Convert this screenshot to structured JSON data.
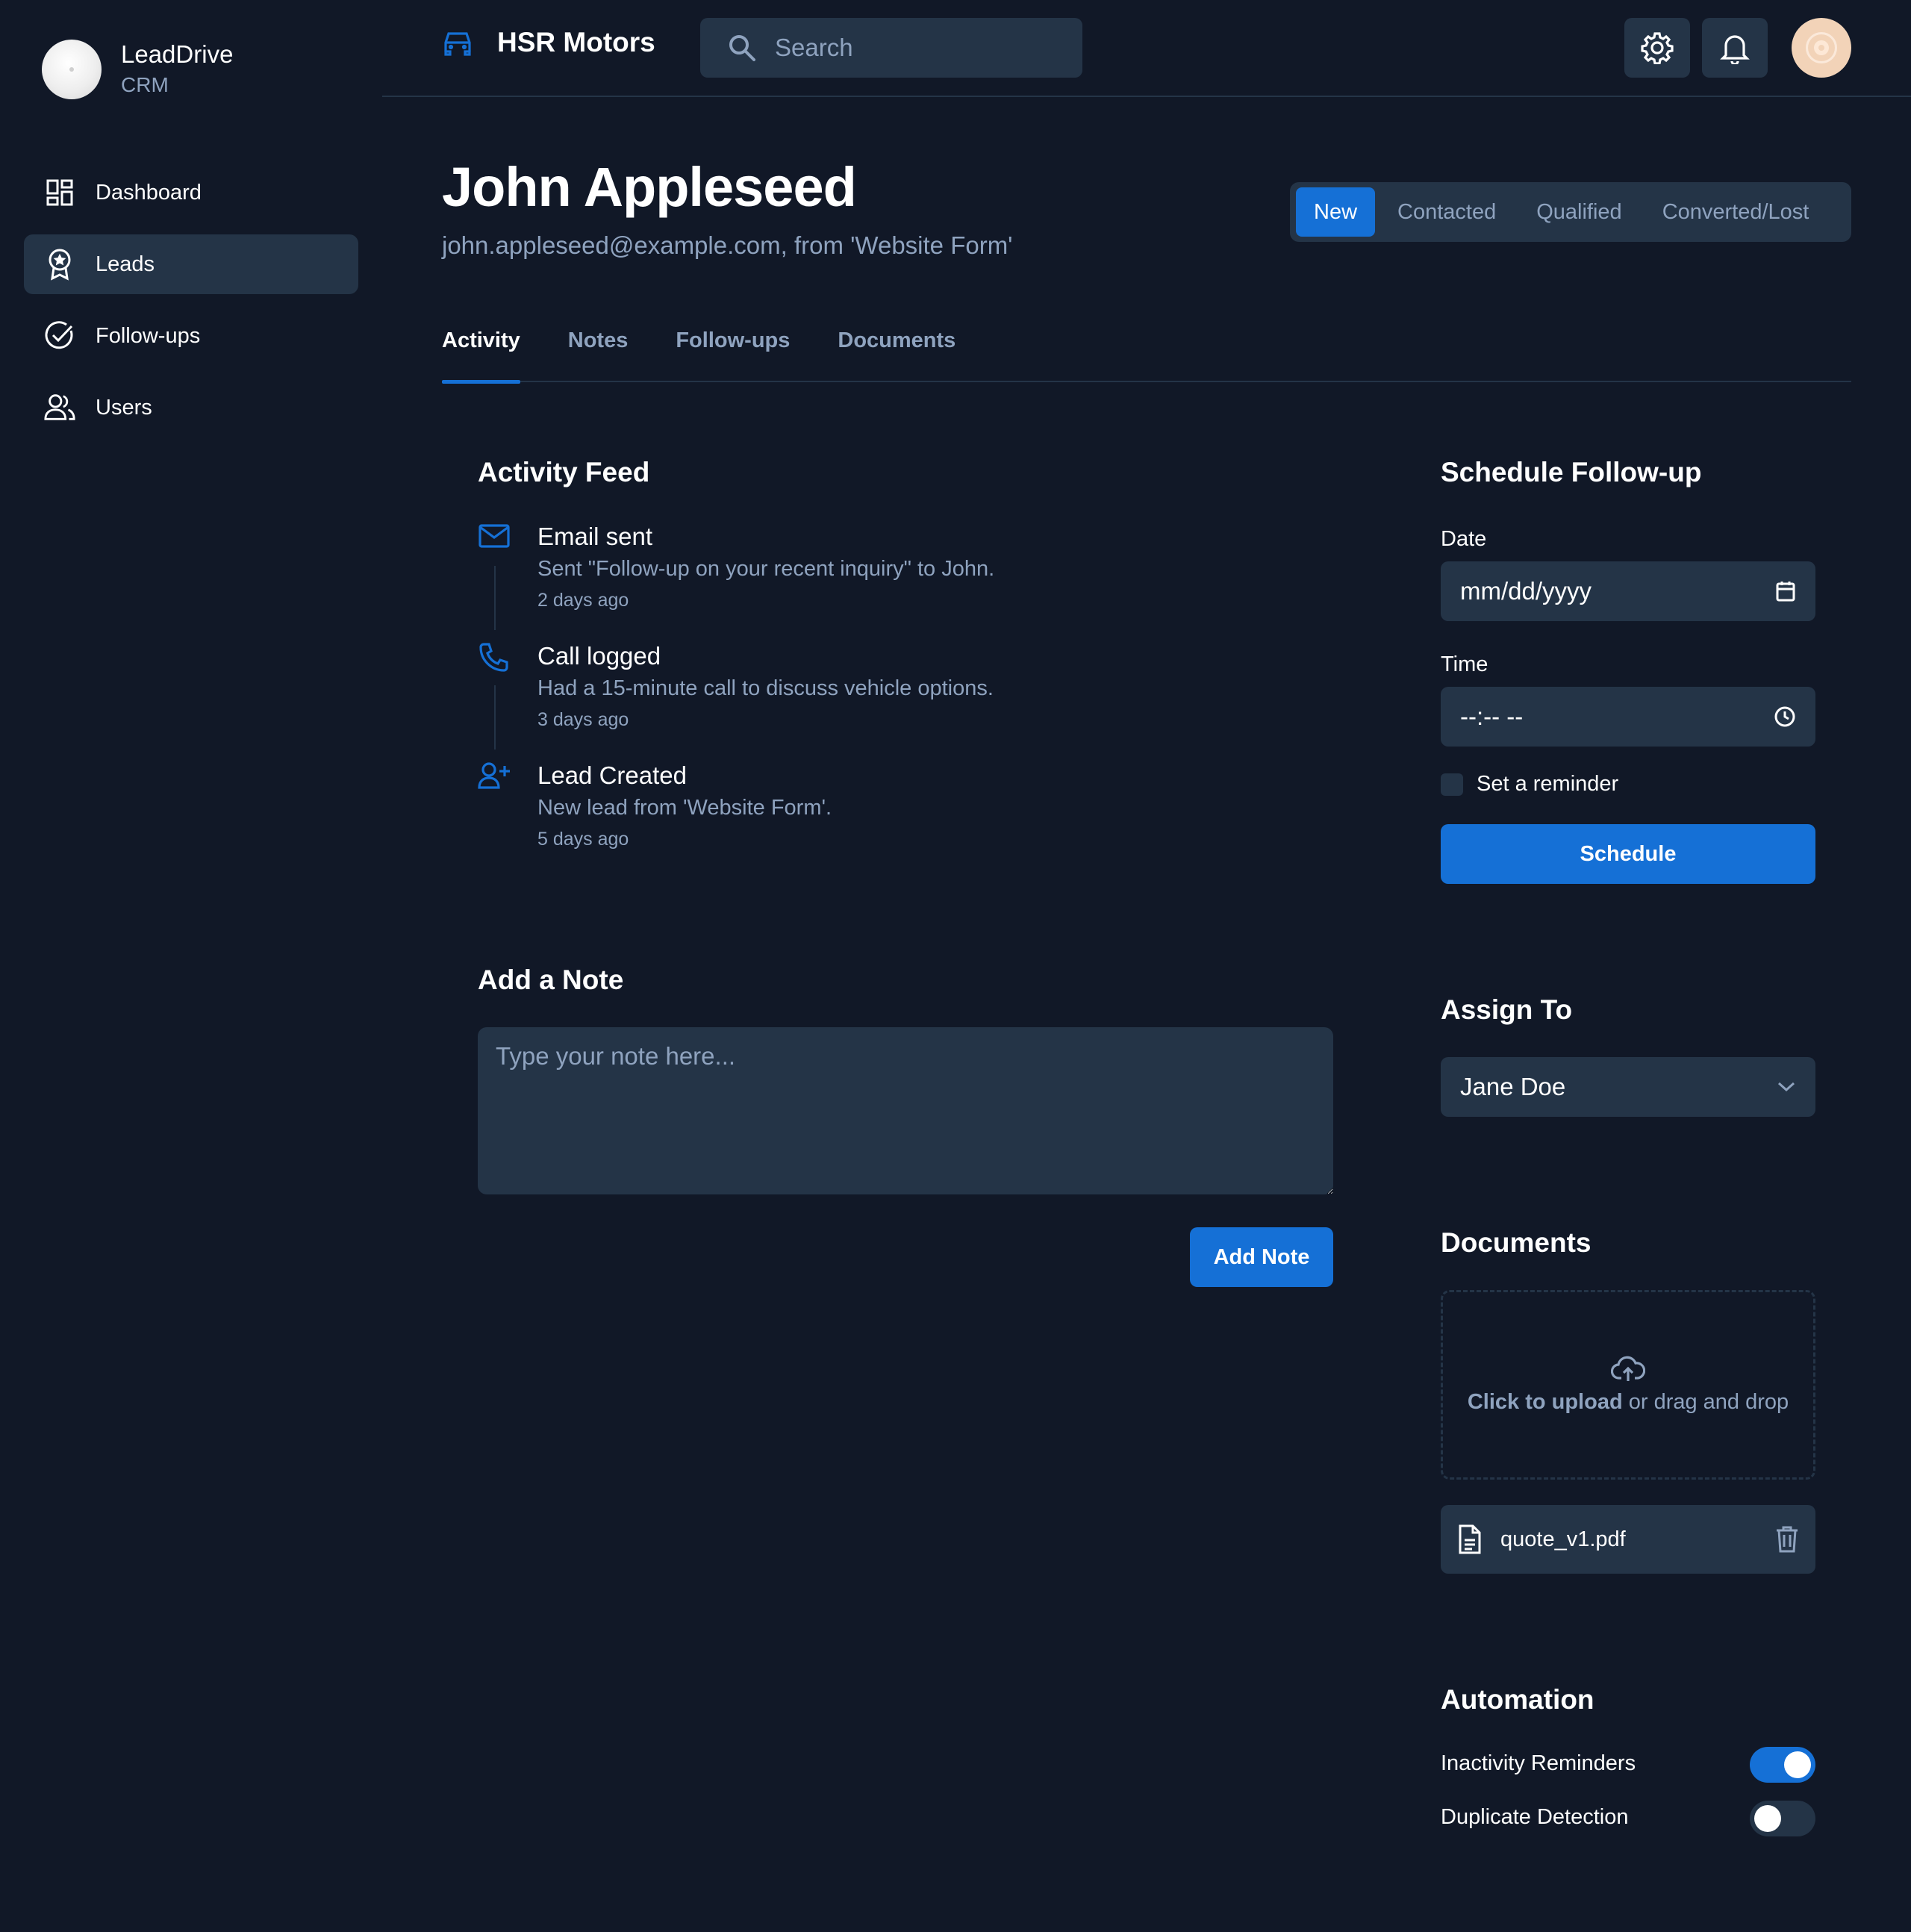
{
  "brand": {
    "name": "LeadDrive",
    "subtitle": "CRM"
  },
  "sidebar": {
    "items": [
      {
        "label": "Dashboard",
        "icon": "dashboard-icon",
        "active": false
      },
      {
        "label": "Leads",
        "icon": "badge-star-icon",
        "active": true
      },
      {
        "label": "Follow-ups",
        "icon": "check-circle-icon",
        "active": false
      },
      {
        "label": "Users",
        "icon": "users-icon",
        "active": false
      }
    ]
  },
  "topbar": {
    "company": "HSR Motors",
    "company_icon": "car-icon",
    "search_placeholder": "Search",
    "settings_icon": "gear-icon",
    "notifications_icon": "bell-icon"
  },
  "lead": {
    "name": "John Appleseed",
    "subtitle": "john.appleseed@example.com, from 'Website Form'"
  },
  "status": {
    "options": [
      "New",
      "Contacted",
      "Qualified",
      "Converted/Lost"
    ],
    "selected": "New"
  },
  "tabs": [
    "Activity",
    "Notes",
    "Follow-ups",
    "Documents"
  ],
  "active_tab": "Activity",
  "activity": {
    "title": "Activity Feed",
    "items": [
      {
        "icon": "mail-icon",
        "title": "Email sent",
        "desc": "Sent \"Follow-up on your recent inquiry\" to John.",
        "time": "2 days ago"
      },
      {
        "icon": "phone-icon",
        "title": "Call logged",
        "desc": "Had a 15-minute call to discuss vehicle options.",
        "time": "3 days ago"
      },
      {
        "icon": "user-plus-icon",
        "title": "Lead Created",
        "desc": "New lead from 'Website Form'.",
        "time": "5 days ago"
      }
    ]
  },
  "note": {
    "title": "Add a Note",
    "placeholder": "Type your note here...",
    "button": "Add Note"
  },
  "followup": {
    "title": "Schedule Follow-up",
    "date_label": "Date",
    "date_value": "mm/dd/yyyy",
    "time_label": "Time",
    "time_value": "--:-- --",
    "reminder_label": "Set a reminder",
    "reminder_checked": false,
    "button": "Schedule"
  },
  "assign": {
    "title": "Assign To",
    "selected": "Jane Doe"
  },
  "documents": {
    "title": "Documents",
    "upload_link": "Click to upload",
    "upload_rest": " or drag and drop",
    "files": [
      {
        "name": "quote_v1.pdf"
      }
    ]
  },
  "automation": {
    "title": "Automation",
    "toggles": [
      {
        "label": "Inactivity Reminders",
        "on": true
      },
      {
        "label": "Duplicate Detection",
        "on": false
      }
    ]
  },
  "colors": {
    "accent": "#1570d6",
    "background": "#111827",
    "surface": "#243447",
    "muted": "#8fa3bf"
  }
}
